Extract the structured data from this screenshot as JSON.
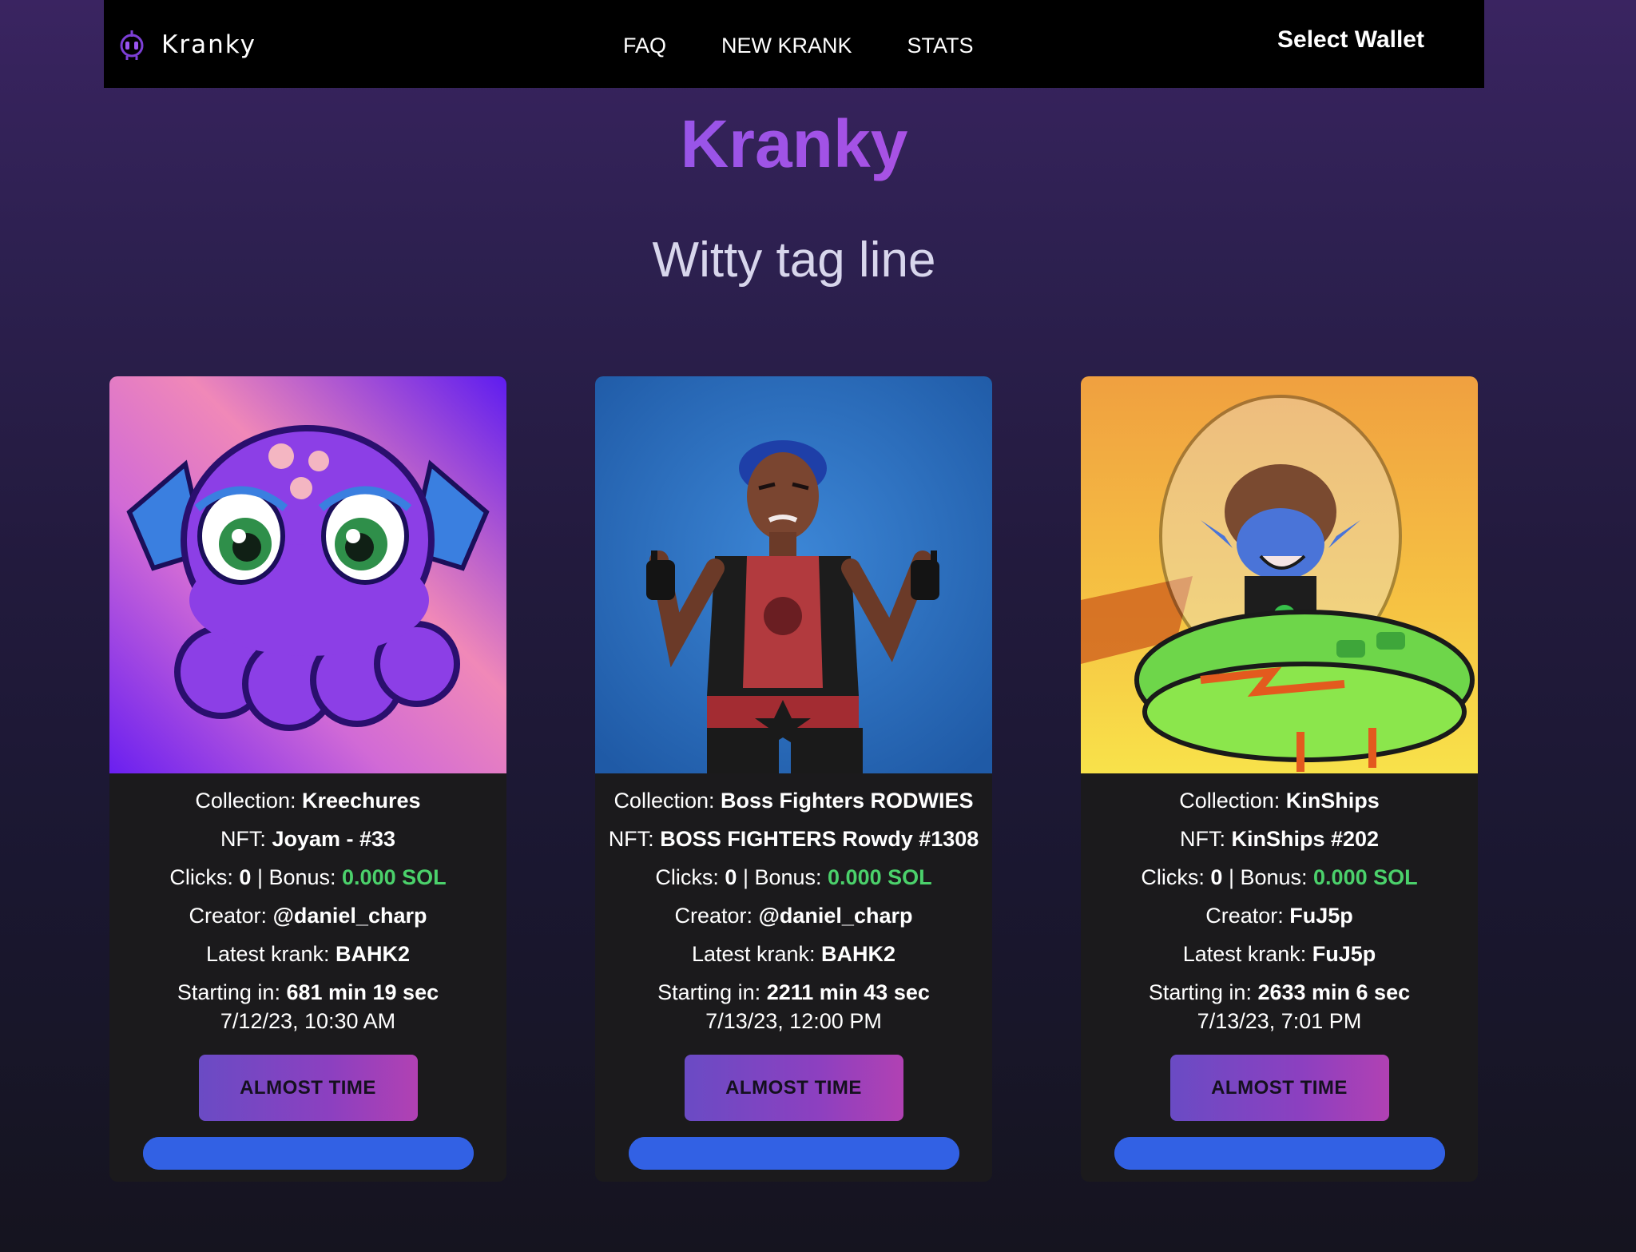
{
  "navbar": {
    "brand": "Kranky",
    "links": [
      "FAQ",
      "NEW KRANK",
      "STATS"
    ],
    "wallet_label": "Select Wallet"
  },
  "hero": {
    "title": "Kranky",
    "tagline": "Witty tag line"
  },
  "labels": {
    "collection": "Collection:",
    "nft": "NFT:",
    "clicks": "Clicks:",
    "bonus": "| Bonus:",
    "creator": "Creator:",
    "latest_krank": "Latest krank:",
    "starting_in": "Starting in:"
  },
  "cards": [
    {
      "image": "purple-octopus-nft",
      "collection": "Kreechures",
      "nft": "Joyam - #33",
      "clicks": "0",
      "bonus": "0.000 SOL",
      "creator": "@daniel_charp",
      "latest_krank": "BAHK2",
      "starting_in": "681 min 19 sec",
      "date": "7/12/23, 10:30 AM",
      "button_label": "ALMOST TIME",
      "progress": 1.0
    },
    {
      "image": "boss-fighter-nft",
      "collection": "Boss Fighters RODWIES",
      "nft": "BOSS FIGHTERS Rowdy #1308",
      "clicks": "0",
      "bonus": "0.000 SOL",
      "creator": "@daniel_charp",
      "latest_krank": "BAHK2",
      "starting_in": "2211 min 43 sec",
      "date": "7/13/23, 12:00 PM",
      "button_label": "ALMOST TIME",
      "progress": 1.0
    },
    {
      "image": "kinship-alien-ship-nft",
      "collection": "KinShips",
      "nft": "KinShips #202",
      "clicks": "0",
      "bonus": "0.000 SOL",
      "creator": "FuJ5p",
      "latest_krank": "FuJ5p",
      "starting_in": "2633 min 6 sec",
      "date": "7/13/23, 7:01 PM",
      "button_label": "ALMOST TIME",
      "progress": 1.0
    }
  ],
  "colors": {
    "accent_purple": "#8a58ec",
    "bonus_green": "#4bd16b",
    "progress_blue": "#3261e4",
    "navbar_bg": "#000000",
    "card_bg": "#1b1a1c"
  }
}
